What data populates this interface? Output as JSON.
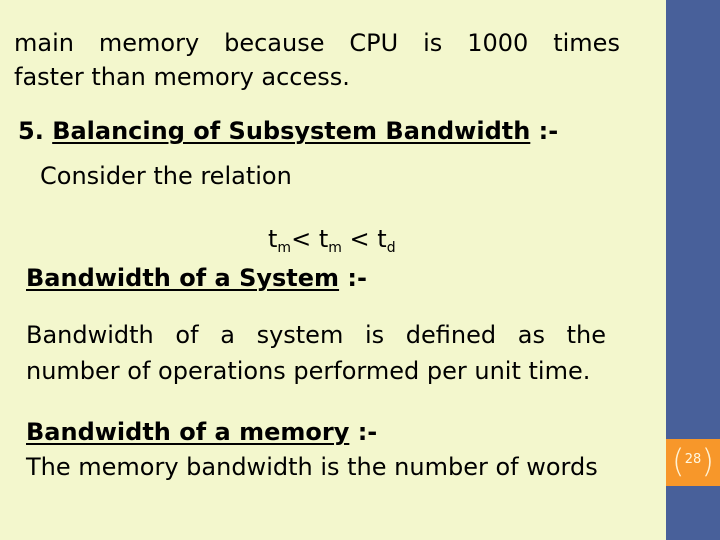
{
  "slide": {
    "para1": {
      "line1_words": [
        "main",
        "memory",
        "because",
        "CPU",
        "is",
        "1000",
        "times"
      ],
      "line2": "faster than memory access."
    },
    "section5": {
      "number": "5.",
      "heading": "Balancing of Subsystem Bandwidth",
      "suffix": ":-",
      "intro": "Consider the relation"
    },
    "relation": {
      "t1": "t",
      "s1": "m",
      "op1": "<",
      "t2": "t",
      "s2": "m",
      "op2": "<",
      "t3": "t",
      "s3": "d"
    },
    "system_bw": {
      "heading": "Bandwidth of a System",
      "suffix": ":-",
      "line1_words": [
        "Bandwidth",
        "of",
        "a",
        "system",
        "is",
        "defined",
        "as",
        "the"
      ],
      "line2": "number of operations performed per unit time."
    },
    "memory_bw": {
      "heading": "Bandwidth of a memory",
      "suffix": ":-",
      "line1": "The memory bandwidth is the number of words"
    },
    "slide_number": "28",
    "colors": {
      "background": "#f3f7cd",
      "sidebar": "#48609a",
      "badge": "#f7972a"
    }
  }
}
